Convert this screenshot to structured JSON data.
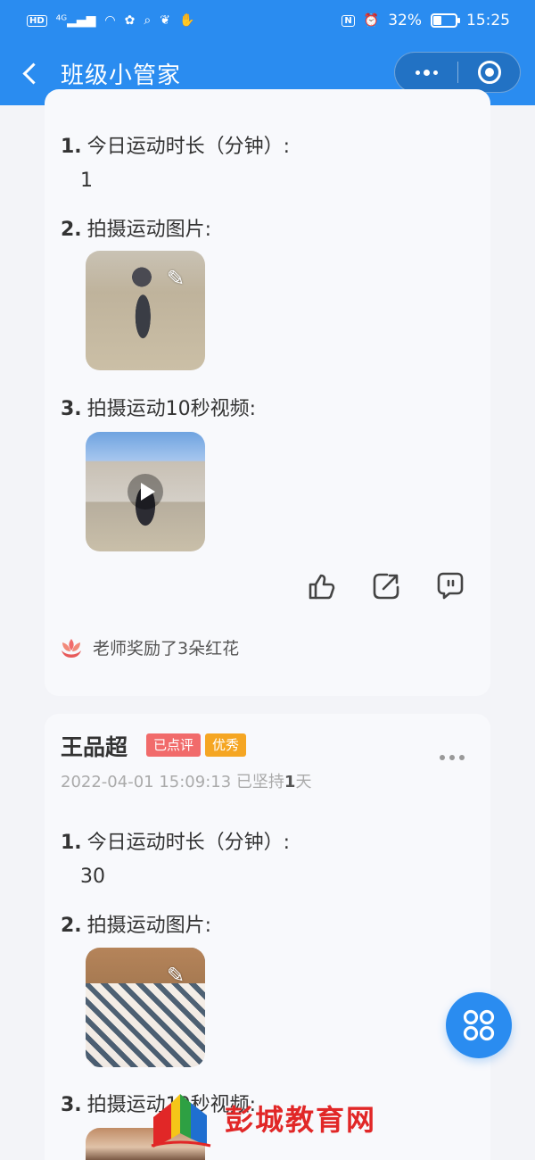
{
  "status_bar": {
    "left_icons": [
      "hd-icon",
      "4g-signal-icon",
      "wifi-icon",
      "app-notification-icon",
      "search-notification-icon",
      "squirrel-app-icon",
      "hand-app-icon"
    ],
    "nfc": "N",
    "battery_percent": "32%",
    "time": "15:25"
  },
  "navbar": {
    "title": "班级小管家"
  },
  "post1": {
    "q1_num": "1.",
    "q1_label": "今日运动时长（分钟）:",
    "q1_answer": "1",
    "q2_num": "2.",
    "q2_label": "拍摄运动图片:",
    "q3_num": "3.",
    "q3_label": "拍摄运动10秒视频:",
    "reward_text": "老师奖励了3朵红花"
  },
  "post2": {
    "author": "王品超",
    "tag_reviewed": "已点评",
    "tag_excellent": "优秀",
    "timestamp": "2022-04-01 15:09:13",
    "streak_prefix": "已坚持",
    "streak_count": "1",
    "streak_unit": "天",
    "q1_num": "1.",
    "q1_label": "今日运动时长（分钟）:",
    "q1_answer": "30",
    "q2_num": "2.",
    "q2_label": "拍摄运动图片:",
    "q3_num": "3.",
    "q3_label": "拍摄运动10秒视频:"
  },
  "watermark": {
    "text": "彭城教育网"
  },
  "colors": {
    "primary": "#2a8cf0",
    "tag_red": "#f16b6b",
    "tag_orange": "#f5a623",
    "watermark_red": "#e12727"
  }
}
